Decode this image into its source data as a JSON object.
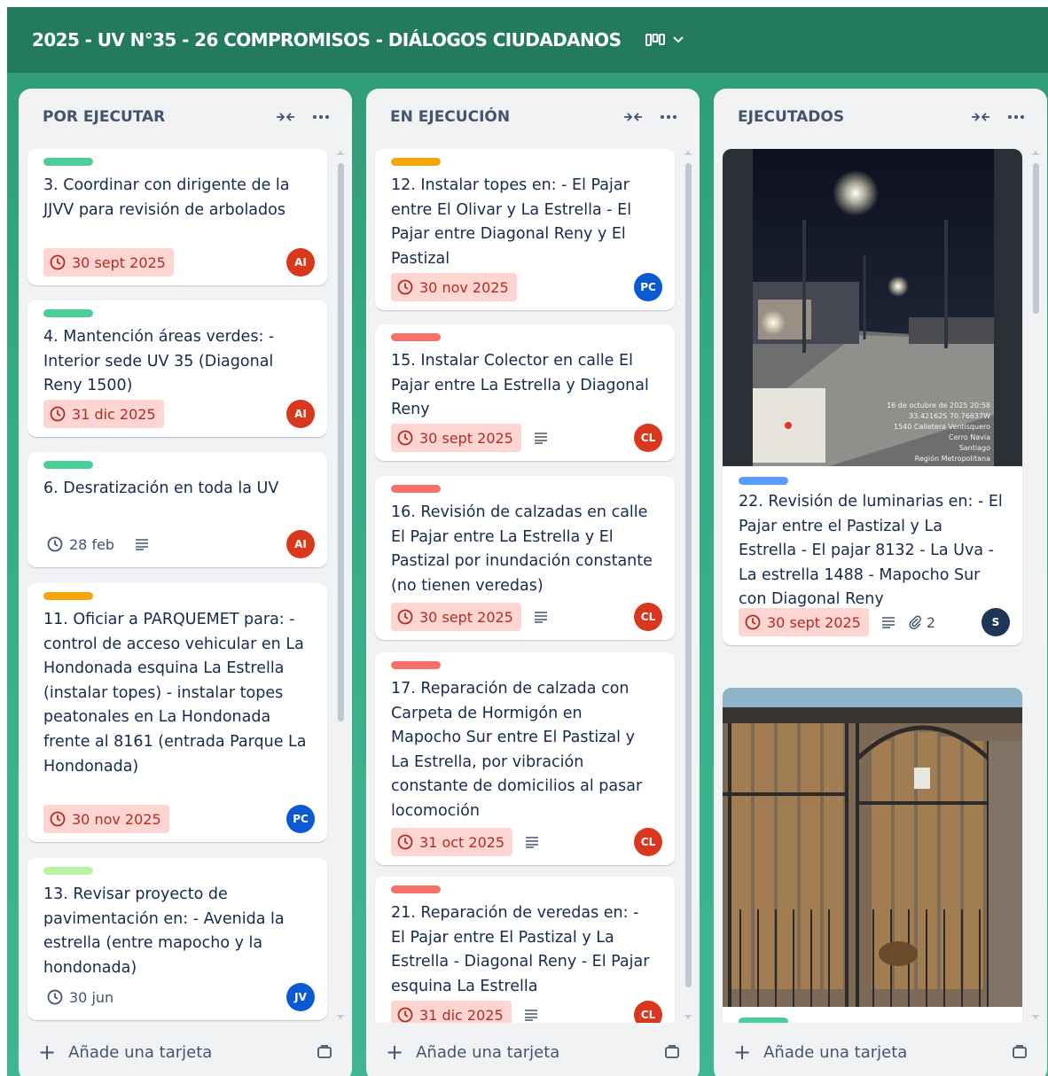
{
  "board": {
    "title": "2025 - UV N°35 - 26 COMPROMISOS - DIÁLOGOS CIUDADANOS"
  },
  "colors": {
    "header_bg": "#247a5c",
    "board_bg": "#35ac86",
    "label_green": "#4bce97",
    "label_orange": "#f5a60b",
    "label_red": "#f87168",
    "label_lime": "#baf3a3",
    "label_blue": "#579dff",
    "avatar_red": "#d9381e",
    "avatar_blue": "#0c5ad3",
    "avatar_navy": "#1d3557"
  },
  "lists": [
    {
      "title": "POR EJECUTAR",
      "add_label": "Añade una tarjeta",
      "cards": [
        {
          "label_color": "green",
          "text": "3. Coordinar con dirigente de la JJVV para revisión de arbolados",
          "date": "30 sept 2025",
          "overdue": true,
          "description": false,
          "avatar": "AI"
        },
        {
          "label_color": "green",
          "text": "4. Mantención áreas verdes: - Interior sede UV 35 (Diagonal Reny 1500)",
          "date": "31 dic 2025",
          "overdue": true,
          "description": false,
          "avatar": "AI"
        },
        {
          "label_color": "green",
          "text": "6. Desratización en toda la UV",
          "date": "28 feb",
          "overdue": false,
          "description": true,
          "avatar": "AI"
        },
        {
          "label_color": "orange",
          "text": "11. Oficiar a PARQUEMET para: - control de acceso vehicular en La Hondonada esquina La Estrella (instalar topes) - instalar topes peatonales en La Hondonada frente al 8161 (entrada Parque La Hondonada)",
          "date": "30 nov 2025",
          "overdue": true,
          "description": false,
          "avatar": "PC"
        },
        {
          "label_color": "lime",
          "text": "13. Revisar proyecto de pavimentación en: - Avenida la estrella (entre mapocho y la hondonada)",
          "date": "30 jun",
          "overdue": false,
          "description": false,
          "avatar": "JV"
        }
      ]
    },
    {
      "title": "EN EJECUCIÓN",
      "add_label": "Añade una tarjeta",
      "cards": [
        {
          "label_color": "orange",
          "text": "12. Instalar topes en: - El Pajar entre El Olivar y La Estrella - El Pajar entre Diagonal Reny y El Pastizal",
          "date": "30 nov 2025",
          "overdue": true,
          "description": false,
          "avatar": "PC"
        },
        {
          "label_color": "red",
          "text": "15. Instalar Colector en calle El Pajar entre La Estrella y Diagonal Reny",
          "date": "30 sept 2025",
          "overdue": true,
          "description": true,
          "avatar": "CL"
        },
        {
          "label_color": "red",
          "text": "16. Revisión de calzadas en calle El Pajar entre La Estrella y El Pastizal por inundación constante (no tienen veredas)",
          "date": "30 sept 2025",
          "overdue": true,
          "description": true,
          "avatar": "CL"
        },
        {
          "label_color": "red",
          "text": "17. Reparación de calzada con Carpeta de Hormigón en Mapocho Sur entre El Pastizal y La Estrella, por vibración constante de domicilios al pasar locomoción",
          "date": "31 oct 2025",
          "overdue": true,
          "description": true,
          "avatar": "CL"
        },
        {
          "label_color": "red",
          "text": "21. Reparación de veredas en: - El Pajar entre El Pastizal y La Estrella - Diagonal Reny - El Pajar esquina La Estrella",
          "date": "31 dic 2025",
          "overdue": true,
          "description": true,
          "avatar": "CL"
        }
      ]
    },
    {
      "title": "EJECUTADOS",
      "add_label": "Añade una tarjeta",
      "cards": [
        {
          "label_color": "blue",
          "text": "22. Revisión de luminarias en: - El Pajar entre el Pastizal y La Estrella - El pajar 8132 - La Uva - La estrella 1488 - Mapocho Sur con Diagonal Reny",
          "date": "30 sept 2025",
          "overdue": true,
          "description": true,
          "attachments": "2",
          "avatar": "S",
          "cover_caption": [
            "16 de octubre de 2025 20:58",
            "33.42162S 70.76637W",
            "1540 Calletera Ventisquero",
            "Cerro Navia",
            "Santiago",
            "Región Metropolitana"
          ]
        },
        {
          "label_color": "green",
          "cover": "gate-photo"
        }
      ]
    }
  ]
}
